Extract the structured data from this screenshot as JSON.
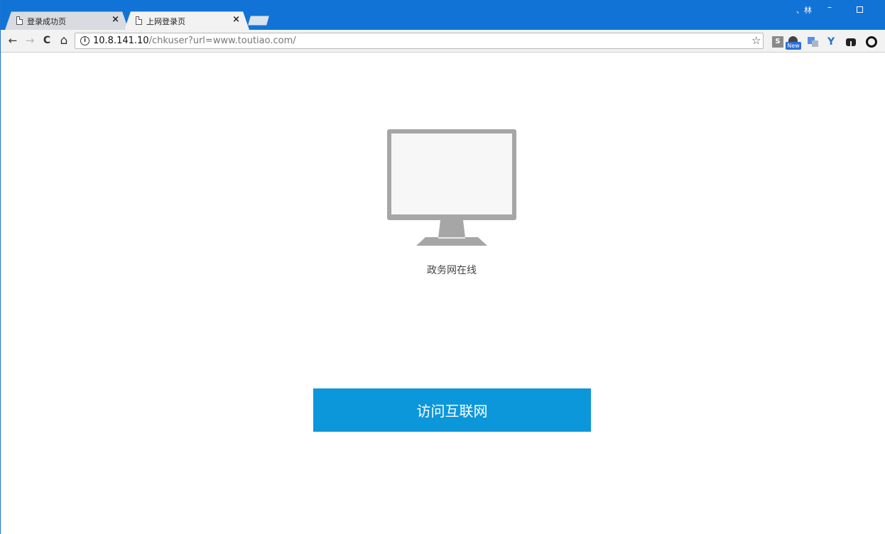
{
  "browser": {
    "tabs": [
      {
        "title": "登录成功页",
        "active": false
      },
      {
        "title": "上网登录页",
        "active": true
      }
    ],
    "window": {
      "user_label": "、林",
      "minimize_glyph": "–"
    },
    "toolbar": {
      "back_glyph": "←",
      "forward_glyph": "→",
      "reload_glyph": "C",
      "home_glyph": "⌂",
      "url_host": "10.8.141.10",
      "url_path": "/chkuser?url=www.toutiao.com/",
      "bookmark_glyph": "☆",
      "extensions": {
        "s_label": "S",
        "new_badge": "New",
        "v_label": "Y"
      }
    }
  },
  "page": {
    "status_caption": "政务网在线",
    "visit_button_label": "访问互联网"
  },
  "colors": {
    "titlebar": "#1273d6",
    "button": "#0d97db",
    "monitor_gray": "#a6a6a6",
    "screen": "#f8f7f8"
  },
  "icons": [
    "page-icon",
    "close-icon",
    "back-icon",
    "forward-icon",
    "reload-icon",
    "home-icon",
    "info-icon",
    "star-icon",
    "monitor-icon"
  ]
}
